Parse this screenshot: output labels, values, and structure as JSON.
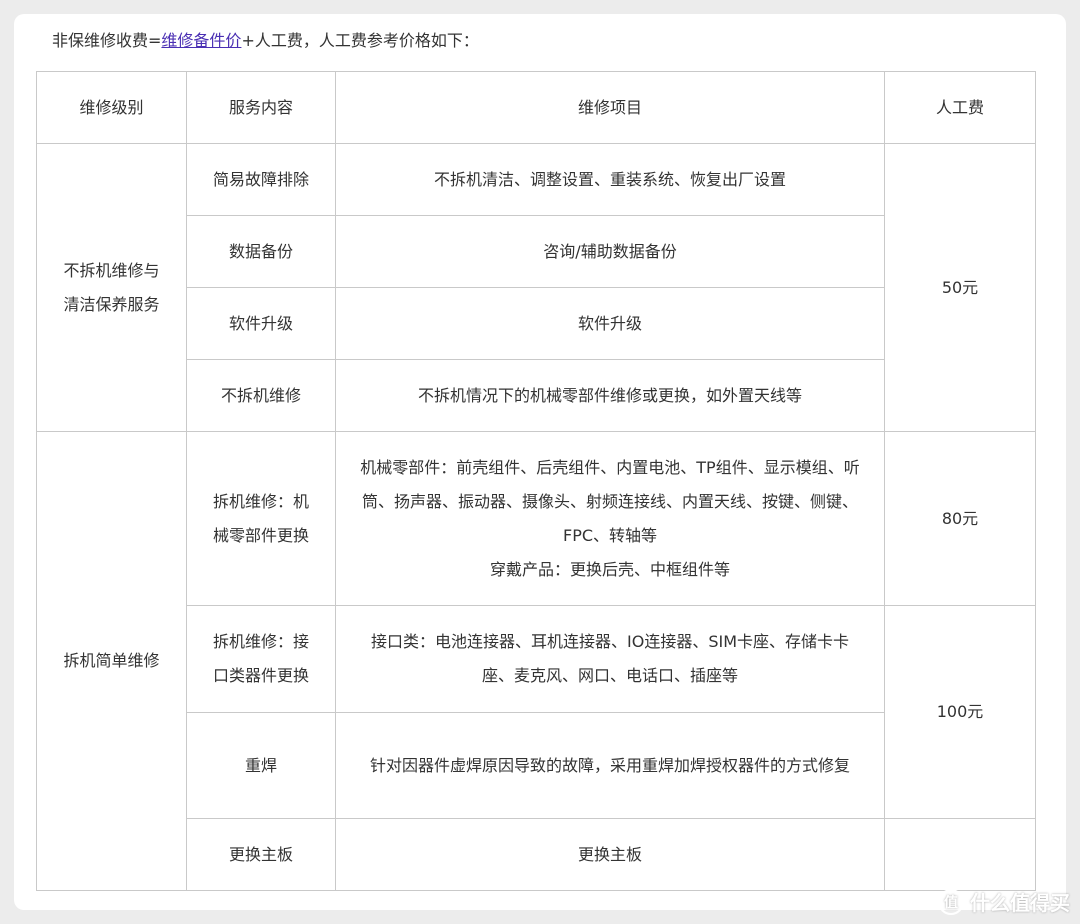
{
  "intro": {
    "prefix": "非保维修收费=",
    "link": "维修备件价",
    "suffix": "+人工费，人工费参考价格如下："
  },
  "table": {
    "headers": [
      "维修级别",
      "服务内容",
      "维修项目",
      "人工费"
    ],
    "groups": [
      {
        "level_line1": "不拆机维修与",
        "level_line2": "清洁保养服务"
      },
      {
        "level": "拆机简单维修"
      }
    ],
    "rows": [
      {
        "service": "简易故障排除",
        "items": "不拆机清洁、调整设置、重装系统、恢复出厂设置"
      },
      {
        "service": "数据备份",
        "items": "咨询/辅助数据备份"
      },
      {
        "service": "软件升级",
        "items": "软件升级"
      },
      {
        "service": "不拆机维修",
        "items": "不拆机情况下的机械零部件维修或更换，如外置天线等"
      },
      {
        "service": "拆机维修：机械零部件更换",
        "items": "机械零部件：前壳组件、后壳组件、内置电池、TP组件、显示模组、听筒、扬声器、振动器、摄像头、射频连接线、内置天线、按键、侧键、FPC、转轴等",
        "items_extra": "穿戴产品：更换后壳、中框组件等"
      },
      {
        "service": "拆机维修：接口类器件更换",
        "items": "接口类：电池连接器、耳机连接器、IO连接器、SIM卡座、存储卡卡座、麦克风、网口、电话口、插座等"
      },
      {
        "service": "重焊",
        "items": "针对因器件虚焊原因导致的故障，采用重焊加焊授权器件的方式修复"
      },
      {
        "service": "更换主板",
        "items": "更换主板"
      }
    ],
    "fees": [
      "50元",
      "80元",
      "100元"
    ]
  },
  "watermark": {
    "text": "什么值得买"
  }
}
